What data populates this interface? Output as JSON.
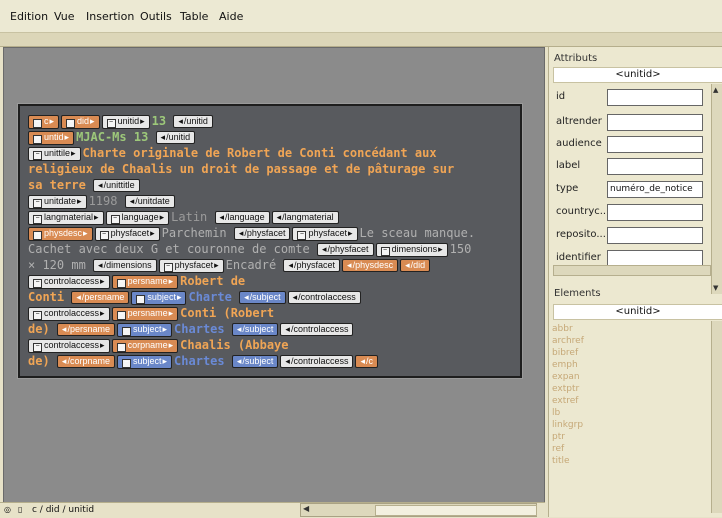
{
  "menu": [
    "Edition",
    "Vue",
    "Insertion",
    "Outils",
    "Table",
    "Aide"
  ],
  "doc": {
    "l1": {
      "c": "c",
      "did": "did",
      "unitid": "unitid",
      "val": "13",
      "close": "/unitid"
    },
    "l2": {
      "untid": "untid",
      "val": "MJAC-Ms 13",
      "close": "/unitid"
    },
    "l3": {
      "tag": "unittile",
      "text": "Charte originale de Robert de Conti concédant aux"
    },
    "l4": {
      "text": "religieux de Chaalis un droit de passage et de pâturage sur"
    },
    "l5": {
      "text": "sa terre",
      "close": "/unittitle"
    },
    "l6": {
      "tag": "unitdate",
      "val": "1198",
      "close": "/unitdate"
    },
    "l7": {
      "t1": "langmaterial",
      "t2": "language",
      "val": "Latin",
      "c1": "/language",
      "c2": "/langmaterial"
    },
    "l8": {
      "t1": "physdesc",
      "t2": "physfacet",
      "v1": "Parchemin",
      "c1": "/physfacet",
      "t3": "physfacet",
      "v2": "Le sceau manque."
    },
    "l9": {
      "v1": "Cachet avec deux G et couronne de comte",
      "c1": "/physfacet",
      "t1": "dimensions",
      "v2": "150"
    },
    "l10": {
      "v1": "× 120 mm",
      "c1": "/dimensions",
      "t1": "physfacet",
      "v2": "Encadré",
      "c2": "/physfacet",
      "c3": "/physdesc",
      "c4": "/did"
    },
    "l11": {
      "t1": "controlaccess",
      "t2": "persname",
      "v1": "Robert de"
    },
    "l12": {
      "v1": "Conti",
      "c1": "/persname",
      "t1": "subject",
      "v2": "Charte",
      "c2": "/subject",
      "c3": "/controlaccess"
    },
    "l13": {
      "t1": "controlaccess",
      "t2": "persname",
      "v1": "Conti (Robert"
    },
    "l14": {
      "v1": "de)",
      "c1": "/persname",
      "t1": "subject",
      "v2": "Chartes",
      "c2": "/subject",
      "c3": "/controlaccess"
    },
    "l15": {
      "t1": "controlaccess",
      "t2": "corpname",
      "v1": "Chaalis (Abbaye"
    },
    "l16": {
      "v1": "de)",
      "c1": "/corpname",
      "t1": "subject",
      "v2": "Chartes",
      "c2": "/subject",
      "c3": "/controlaccess",
      "c4": "/c"
    }
  },
  "attributes": {
    "title": "Attributs",
    "element": "<unitid>",
    "fields": [
      {
        "label": "id",
        "value": ""
      },
      {
        "label": "altrender",
        "value": ""
      },
      {
        "label": "audience",
        "value": ""
      },
      {
        "label": "label",
        "value": ""
      },
      {
        "label": "type",
        "value": "numéro_de_notice"
      },
      {
        "label": "countryc...",
        "value": ""
      },
      {
        "label": "reposito...",
        "value": ""
      },
      {
        "label": "identifier",
        "value": ""
      }
    ]
  },
  "elements": {
    "title": "Elements",
    "element": "<unitid>",
    "items": [
      "abbr",
      "archref",
      "bibref",
      "emph",
      "expan",
      "extptr",
      "extref",
      "lb",
      "linkgrp",
      "ptr",
      "ref",
      "title"
    ]
  },
  "status": {
    "path": "c / did / unitid"
  }
}
